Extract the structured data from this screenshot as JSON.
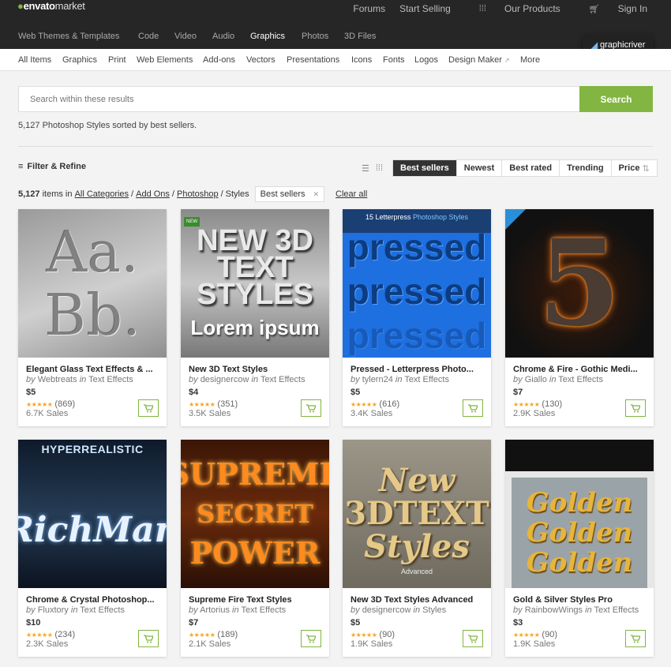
{
  "brand": {
    "logo": "envato",
    "logo_suffix": "market"
  },
  "top_links": {
    "forums": "Forums",
    "start_selling": "Start Selling",
    "our_products": "Our Products",
    "sign_in": "Sign In"
  },
  "category_nav": [
    "Web Themes & Templates",
    "Code",
    "Video",
    "Audio",
    "Graphics",
    "Photos",
    "3D Files"
  ],
  "category_active": "Graphics",
  "site_badge": "graphicriver",
  "sub_nav": [
    "All Items",
    "Graphics",
    "Print",
    "Web Elements",
    "Add-ons",
    "Vectors",
    "Presentations",
    "Icons",
    "Fonts",
    "Logos",
    "Design Maker",
    "More"
  ],
  "search": {
    "placeholder": "Search within these results",
    "button": "Search"
  },
  "summary": "5,127 Photoshop Styles sorted by best sellers.",
  "filter_label": "Filter & Refine",
  "sort_tabs": [
    "Best sellers",
    "Newest",
    "Best rated",
    "Trending",
    "Price"
  ],
  "sort_active": "Best sellers",
  "breadcrumb": {
    "count": "5,127",
    "items_in": "items in",
    "all_categories": "All Categories",
    "add_ons": "Add Ons",
    "photoshop": "Photoshop",
    "styles": "Styles",
    "chip": "Best sellers",
    "clear_all": "Clear all"
  },
  "products": [
    {
      "title": "Elegant Glass Text Effects & ...",
      "author": "Webtreats",
      "category": "Text Effects",
      "price": "$5",
      "rating": "(869)",
      "sales": "6.7K Sales",
      "thumb_text": "Aa. Bb."
    },
    {
      "title": "New 3D Text Styles",
      "author": "designercow",
      "category": "Text Effects",
      "price": "$4",
      "rating": "(351)",
      "sales": "3.5K Sales",
      "thumb_text": "NEW 3D TEXT STYLES",
      "thumb_sub": "Lorem ipsum"
    },
    {
      "title": "Pressed - Letterpress Photo...",
      "author": "tylern24",
      "category": "Text Effects",
      "price": "$5",
      "rating": "(616)",
      "sales": "3.4K Sales",
      "thumb_text": "pressed",
      "thumb_head": "15 Letterpress",
      "thumb_head2": "Photoshop Styles"
    },
    {
      "title": "Chrome & Fire - Gothic Medi...",
      "author": "Giallo",
      "category": "Text Effects",
      "price": "$7",
      "rating": "(130)",
      "sales": "2.9K Sales",
      "thumb_text": "5"
    },
    {
      "title": "Chrome & Crystal Photoshop...",
      "author": "Fluxtory",
      "category": "Text Effects",
      "price": "$10",
      "rating": "(234)",
      "sales": "2.3K Sales",
      "thumb_text": "RichMan",
      "thumb_head": "HYPERREALISTIC"
    },
    {
      "title": "Supreme Fire Text Styles",
      "author": "Artorius",
      "category": "Text Effects",
      "price": "$7",
      "rating": "(189)",
      "sales": "2.1K Sales",
      "thumb_lines": [
        "SUPREME",
        "SECRET",
        "POWER"
      ]
    },
    {
      "title": "New 3D Text Styles Advanced",
      "author": "designercow",
      "category": "Styles",
      "price": "$5",
      "rating": "(90)",
      "sales": "1.9K Sales",
      "thumb_lines": [
        "New",
        "3DTEXT",
        "Styles"
      ],
      "thumb_sub": "Advanced"
    },
    {
      "title": "Gold & Silver Styles Pro",
      "author": "RainbowWings",
      "category": "Text Effects",
      "price": "$3",
      "rating": "(90)",
      "sales": "1.9K Sales",
      "thumb_lines": [
        "Golden",
        "Golden",
        "Golden"
      ]
    }
  ],
  "by_label": "by",
  "in_label": "in",
  "colors": {
    "accent_green": "#82b541",
    "header_bg": "#262626",
    "star": "#f5a623"
  },
  "icons": [
    "list-view-icon",
    "grid-view-icon",
    "cart-icon",
    "products-grid-icon",
    "filter-icon",
    "external-link-icon",
    "sort-arrows-icon"
  ]
}
